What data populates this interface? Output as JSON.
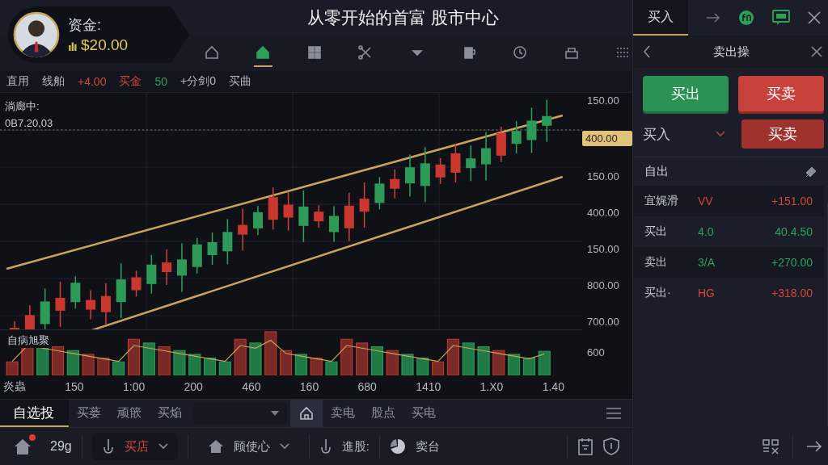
{
  "profile": {
    "label": "资金:",
    "balance": "$20.00"
  },
  "title": "从零开始的首富 股市中心",
  "toolbar": [
    {
      "selected": false
    },
    {
      "selected": true
    },
    {
      "selected": false
    },
    {
      "selected": false
    },
    {
      "selected": false
    },
    {
      "selected": false
    },
    {
      "selected": false
    },
    {
      "selected": false
    },
    {
      "selected": false
    }
  ],
  "right_tabs": [
    {
      "label": "买入",
      "selected": true
    }
  ],
  "info_strip": [
    {
      "text": "直用",
      "color": "#b4b8c1"
    },
    {
      "text": "线舶",
      "color": "#b4b8c1"
    },
    {
      "text": "+4.00",
      "color": "#d2453c"
    },
    {
      "text": "买金",
      "color": "#d2453c"
    },
    {
      "text": "50",
      "color": "#2fa05a"
    },
    {
      "text": "+分剑0",
      "color": "#b4b8c1"
    },
    {
      "text": "买曲",
      "color": "#b4b8c1"
    }
  ],
  "chart": {
    "overlay_label": "淌廊中:",
    "overlay_value": "0B7.20,03",
    "y_labels": [
      {
        "text": "150.00",
        "kind": "plain"
      },
      {
        "text": "400.00",
        "kind": "tag"
      },
      {
        "text": "150.00",
        "kind": "plain"
      },
      {
        "text": "400.00",
        "kind": "plain"
      },
      {
        "text": "150.00",
        "kind": "plain"
      },
      {
        "text": "800.00",
        "kind": "plain"
      },
      {
        "text": "700.00",
        "kind": "plain"
      }
    ],
    "volume_label": "自病旭聚",
    "volume_y_label": "600",
    "x_labels": [
      "炎蟲",
      "150",
      "1:00",
      "200",
      "460",
      "160",
      "680",
      "1410",
      "1.X0",
      "1.40"
    ]
  },
  "panel": {
    "title": "卖出操",
    "buttons": [
      {
        "label": "买出",
        "kind": "buy"
      },
      {
        "label": "买卖",
        "kind": "sell"
      }
    ],
    "select": {
      "value": "买入"
    },
    "select_button": "买卖",
    "list_title": "自出",
    "rows": [
      {
        "name": "宜娓滑",
        "code": "VV",
        "change": "+151.00",
        "color": "#d2453c"
      },
      {
        "name": "买出",
        "code": "4.0",
        "change": "40.4.50",
        "color": "#2fa05a"
      },
      {
        "name": "卖出",
        "code": "3/A",
        "change": "+270.00",
        "color": "#2fa05a"
      },
      {
        "name": "买出·",
        "code": "HG",
        "change": "+318.00",
        "color": "#d2453c"
      }
    ]
  },
  "bottom_tabs": [
    {
      "label": "自选投",
      "selected": true
    },
    {
      "label": "买蒌",
      "selected": false
    },
    {
      "label": "顽篏",
      "selected": false
    },
    {
      "label": "买焔",
      "selected": false
    }
  ],
  "bottom_tabs_2": [
    {
      "label": "卖电",
      "selected": false
    },
    {
      "label": "股点",
      "selected": false
    },
    {
      "label": "买电",
      "selected": false
    }
  ],
  "status_bar": {
    "home_badge": true,
    "count": "29g",
    "dropdowns": [
      {
        "label": "买店",
        "selected": true
      },
      {
        "label": "顾使心",
        "selected": false
      }
    ],
    "link": "進股:",
    "pie_label": "窦台"
  }
}
